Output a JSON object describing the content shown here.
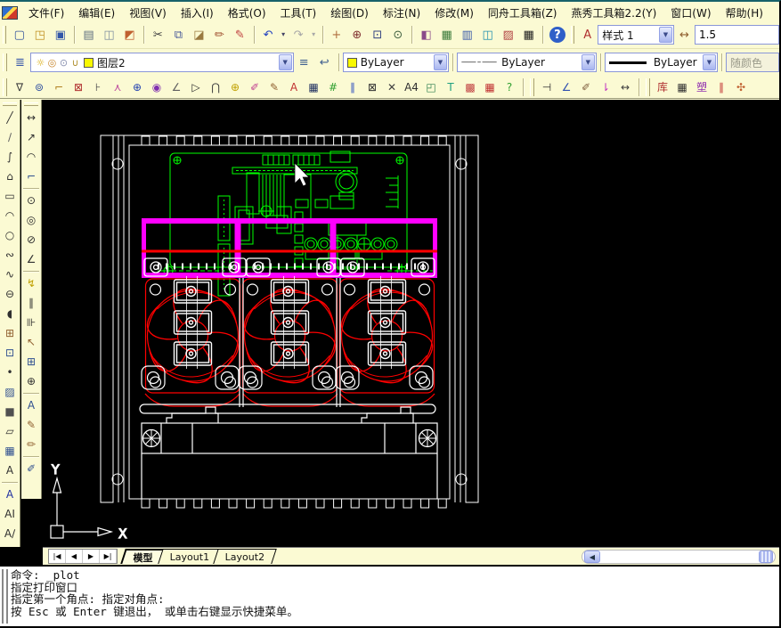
{
  "menu": {
    "items": [
      "文件(F)",
      "编辑(E)",
      "视图(V)",
      "插入(I)",
      "格式(O)",
      "工具(T)",
      "绘图(D)",
      "标注(N)",
      "修改(M)",
      "同舟工具箱(Z)",
      "燕秀工具箱2.2(Y)",
      "窗口(W)",
      "帮助(H)"
    ]
  },
  "ui": {
    "dropdown_arrow": "▼",
    "left_scroll_arrow": "◀"
  },
  "toolbar_standard": {
    "groups": [
      [
        {
          "n": "new-icon",
          "g": "▢",
          "c": "#33539c"
        },
        {
          "n": "open-icon",
          "g": "◳",
          "c": "#c09020"
        },
        {
          "n": "save-icon",
          "g": "▣",
          "c": "#3356a8"
        }
      ],
      [
        {
          "n": "plot-icon",
          "g": "▤",
          "c": "#607080"
        },
        {
          "n": "plot-preview-icon",
          "g": "◫",
          "c": "#8090a0"
        },
        {
          "n": "publish-icon",
          "g": "◩",
          "c": "#c06030"
        }
      ],
      [
        {
          "n": "cut-icon",
          "g": "✂",
          "c": "#404040"
        },
        {
          "n": "copy-icon",
          "g": "⧉",
          "c": "#4a5a9a"
        },
        {
          "n": "paste-icon",
          "g": "◪",
          "c": "#9a7a40"
        },
        {
          "n": "match-properties-icon",
          "g": "✏",
          "c": "#a05030"
        },
        {
          "n": "match-light-icon",
          "g": "✎",
          "c": "#c04040"
        }
      ],
      [
        {
          "n": "undo-icon",
          "g": "↶",
          "c": "#2040c0"
        },
        {
          "n": "undo-dropdown-icon",
          "g": "▾",
          "s": "caret"
        },
        {
          "n": "redo-icon",
          "g": "↷",
          "c": "#a8a8a8"
        },
        {
          "n": "redo-dropdown-icon",
          "g": "▾",
          "s": "caret",
          "c": "#a8a8a8"
        }
      ],
      [
        {
          "n": "pan-icon",
          "g": "+",
          "c": "#b07040"
        },
        {
          "n": "zoom-realtime-icon",
          "g": "⊕",
          "c": "#803030"
        },
        {
          "n": "zoom-window-icon",
          "g": "⊡",
          "c": "#304080"
        },
        {
          "n": "zoom-previous-icon",
          "g": "⊙",
          "c": "#406040"
        }
      ],
      [
        {
          "n": "properties-icon",
          "g": "◧",
          "c": "#8a4a8a"
        },
        {
          "n": "designcenter-icon",
          "g": "▦",
          "c": "#3a7a3a"
        },
        {
          "n": "tool-palettes-icon",
          "g": "▥",
          "c": "#3a5aaa"
        },
        {
          "n": "sheetset-icon",
          "g": "◫",
          "c": "#2090b0"
        },
        {
          "n": "markup-icon",
          "g": "▨",
          "c": "#b04040"
        },
        {
          "n": "quickcalc-icon",
          "g": "▦",
          "c": "#202020"
        }
      ],
      [
        {
          "n": "help-icon",
          "g": "?",
          "c": "#ffffff",
          "s": "help"
        }
      ]
    ],
    "text_style_icon": {
      "n": "text-style-icon",
      "g": "A",
      "c": "#b03030"
    },
    "style_value": "样式 1",
    "dim_style_icon": {
      "n": "dim-style-icon",
      "g": "↔",
      "c": "#906030"
    },
    "scale_value": "1.5"
  },
  "toolbar_layers": {
    "layers_icon": [
      {
        "n": "layers-icon",
        "g": "≣",
        "c": "#3a5aaa"
      }
    ],
    "layer_state_icons": [
      {
        "n": "bulb-on-icon",
        "g": "☼",
        "c": "#d8a800"
      },
      {
        "n": "freeze-sun-icon",
        "g": "◎",
        "c": "#c88830"
      },
      {
        "n": "viewport-freeze-icon",
        "g": "⊙",
        "c": "#8890b0"
      },
      {
        "n": "unlock-icon",
        "g": "∪",
        "c": "#b09030"
      }
    ],
    "layer_value": "图层2",
    "layer_swatch": "#f8f800",
    "buttons": [
      {
        "n": "make-object-layer-current-icon",
        "g": "≡",
        "c": "#406090"
      },
      {
        "n": "layer-previous-icon",
        "g": "↩",
        "c": "#406090"
      }
    ],
    "color_value": "ByLayer",
    "color_swatch": "#f8f800",
    "linetype_pattern": "—— – ——",
    "linetype_value": "ByLayer",
    "lineweight_value": "ByLayer",
    "plotstyle_value": "随颜色"
  },
  "toolbar_osnap": {
    "groups": [
      [
        {
          "n": "osnap-settings-icon",
          "g": "∇",
          "c": "#404040"
        },
        {
          "n": "snap-from-icon",
          "g": "⊚",
          "c": "#3050a0"
        },
        {
          "n": "snap-endpoint-icon",
          "g": "⌐",
          "c": "#b08020"
        },
        {
          "n": "snap-window-icon",
          "g": "⊠",
          "c": "#b03030"
        },
        {
          "n": "track-point-icon",
          "g": "⊦",
          "c": "#505050"
        },
        {
          "n": "snap-intersection-icon",
          "g": "⋏",
          "c": "#c050a0"
        },
        {
          "n": "snap-center-icon",
          "g": "⊕",
          "c": "#2040b0"
        },
        {
          "n": "snap-quadrant-icon",
          "g": "◉",
          "c": "#8030b0"
        },
        {
          "n": "snap-tangent-icon",
          "g": "∠",
          "c": "#606060"
        },
        {
          "n": "snap-perpendicular-icon",
          "g": "▷",
          "c": "#303030"
        },
        {
          "n": "snap-parallel-icon",
          "g": "⋂",
          "c": "#404040"
        },
        {
          "n": "snap-node-icon",
          "g": "⊕",
          "c": "#c0a000"
        },
        {
          "n": "colored-brush-icon",
          "g": "✐",
          "c": "#c04090"
        },
        {
          "n": "pencil-tool-icon",
          "g": "✎",
          "c": "#906030"
        },
        {
          "n": "text-tool-icon",
          "g": "A",
          "c": "#c03030"
        },
        {
          "n": "table-tool-icon",
          "g": "▦",
          "c": "#203060"
        },
        {
          "n": "grid-tool-icon",
          "g": "#",
          "c": "#30a030"
        },
        {
          "n": "column-tool-icon",
          "g": "∥",
          "c": "#3050c0"
        },
        {
          "n": "erase-tool-icon",
          "g": "⊠",
          "c": "#303030"
        },
        {
          "n": "break-tool-icon",
          "g": "✕",
          "c": "#404040"
        },
        {
          "n": "a4-paper-icon",
          "g": "A4",
          "c": "#303030"
        },
        {
          "n": "scale-tool-icon",
          "g": "◰",
          "c": "#308050"
        },
        {
          "n": "text-green-icon",
          "g": "T",
          "c": "#20a080"
        },
        {
          "n": "dim-table-icon",
          "g": "▩",
          "c": "#c04040"
        },
        {
          "n": "red-table-icon",
          "g": "▦",
          "c": "#c03030"
        },
        {
          "n": "yanxiu-help-icon",
          "g": "?",
          "c": "#30a030"
        }
      ],
      [
        {
          "n": "quick-linear-dim-icon",
          "g": "⊣",
          "c": "#303030"
        },
        {
          "n": "angle-dim-icon",
          "g": "∠",
          "c": "#3050b0"
        },
        {
          "n": "brush-dim-icon",
          "g": "✐",
          "c": "#806040"
        },
        {
          "n": "arrow-down-dim-icon",
          "g": "⇂",
          "c": "#c030c0"
        },
        {
          "n": "horizontal-dim-icon",
          "g": "↔",
          "c": "#404040"
        }
      ],
      [
        {
          "n": "library-icon",
          "g": "库",
          "c": "#b03030"
        },
        {
          "n": "moldbase-icon",
          "g": "▦",
          "c": "#303030"
        },
        {
          "n": "plastic-icon",
          "g": "塑",
          "c": "#9030b0"
        },
        {
          "n": "stripes-icon",
          "g": "∥",
          "c": "#c03030"
        },
        {
          "n": "flower-icon",
          "g": "✣",
          "c": "#c06030"
        }
      ]
    ]
  },
  "draw_toolbar": {
    "items": [
      {
        "n": "line-icon",
        "g": "╱",
        "c": "#303030"
      },
      {
        "n": "construction-line-icon",
        "g": "∕",
        "c": "#606060"
      },
      {
        "n": "polyline-icon",
        "g": "∫",
        "c": "#303030"
      },
      {
        "n": "polygon-icon",
        "g": "⌂",
        "c": "#303030"
      },
      {
        "n": "rectangle-icon",
        "g": "▭",
        "c": "#303030"
      },
      {
        "n": "arc-icon",
        "g": "◠",
        "c": "#303030"
      },
      {
        "n": "circle-icon",
        "g": "○",
        "c": "#303030"
      },
      {
        "n": "revcloud-icon",
        "g": "∾",
        "c": "#303030"
      },
      {
        "n": "spline-icon",
        "g": "∿",
        "c": "#303030"
      },
      {
        "n": "ellipse-icon",
        "g": "⊖",
        "c": "#303030"
      },
      {
        "n": "ellipse-arc-icon",
        "g": "◖",
        "c": "#303030"
      },
      {
        "n": "insert-block-icon",
        "g": "⊞",
        "c": "#906030"
      },
      {
        "n": "make-block-icon",
        "g": "⊡",
        "c": "#305090"
      },
      {
        "n": "point-icon",
        "g": "•",
        "c": "#303030"
      },
      {
        "n": "hatch-icon",
        "g": "▨",
        "c": "#305090"
      },
      {
        "n": "gradient-icon",
        "g": "■",
        "c": "#505050"
      },
      {
        "n": "region-icon",
        "g": "▱",
        "c": "#303030"
      },
      {
        "n": "table-icon",
        "g": "▦",
        "c": "#305090"
      },
      {
        "n": "mtext-icon",
        "g": "A",
        "c": "#303030"
      }
    ],
    "text_items": [
      {
        "n": "text-icon",
        "g": "A",
        "c": "#2030a0"
      },
      {
        "n": "single-line-text-icon",
        "g": "AI",
        "c": "#303030"
      },
      {
        "n": "edit-text-icon",
        "g": "A∕",
        "c": "#303030"
      }
    ]
  },
  "dim_toolbar": {
    "items1": [
      {
        "n": "linear-dimension-icon",
        "g": "↔",
        "c": "#303030"
      },
      {
        "n": "aligned-dimension-icon",
        "g": "↗",
        "c": "#303030"
      },
      {
        "n": "arc-length-dimension-icon",
        "g": "◠",
        "c": "#303030"
      },
      {
        "n": "ordinate-dimension-icon",
        "g": "⌐",
        "c": "#305090"
      }
    ],
    "items2": [
      {
        "n": "radius-dimension-icon",
        "g": "⊙",
        "c": "#303030"
      },
      {
        "n": "jogged-dimension-icon",
        "g": "◎",
        "c": "#303030"
      },
      {
        "n": "diameter-dimension-icon",
        "g": "⊘",
        "c": "#303030"
      },
      {
        "n": "angular-dimension-icon",
        "g": "∠",
        "c": "#303030"
      }
    ],
    "items3": [
      {
        "n": "quick-dimension-icon",
        "g": "↯",
        "c": "#c0a000"
      },
      {
        "n": "baseline-dimension-icon",
        "g": "∥",
        "c": "#303030"
      },
      {
        "n": "continue-dimension-icon",
        "g": "⊪",
        "c": "#303030"
      },
      {
        "n": "quick-leader-icon",
        "g": "↖",
        "c": "#906030"
      },
      {
        "n": "tolerance-icon",
        "g": "⊞",
        "c": "#305090"
      },
      {
        "n": "center-mark-icon",
        "g": "⊕",
        "c": "#303030"
      }
    ],
    "items4": [
      {
        "n": "dimension-text-icon",
        "g": "A",
        "c": "#305090"
      },
      {
        "n": "dimension-edit-icon",
        "g": "✎",
        "c": "#906030"
      },
      {
        "n": "dimension-text-edit-icon",
        "g": "✏",
        "c": "#906030"
      }
    ],
    "items5": [
      {
        "n": "dimension-update-icon",
        "g": "✐",
        "c": "#305090"
      }
    ]
  },
  "canvas": {
    "ucs": {
      "x_label": "X",
      "y_label": "Y"
    },
    "colors": {
      "background": "#000000",
      "outline": "#ffffff",
      "pcb": "#00ff00",
      "fans": "#ff0000",
      "busbar": "#ff00ff"
    }
  },
  "layout_tabs": {
    "nav": [
      {
        "n": "tab-first-icon",
        "g": "|◀"
      },
      {
        "n": "tab-prev-icon",
        "g": "◀"
      },
      {
        "n": "tab-next-icon",
        "g": "▶"
      },
      {
        "n": "tab-last-icon",
        "g": "▶|"
      }
    ],
    "tabs": [
      {
        "label": "模型",
        "active": true
      },
      {
        "label": "Layout1",
        "active": false
      },
      {
        "label": "Layout2",
        "active": false
      }
    ]
  },
  "command": {
    "lines": [
      "命令: _plot",
      "指定打印窗口",
      "指定第一个角点: 指定对角点:",
      "按 Esc 或 Enter 键退出， 或单击右键显示快捷菜单。"
    ]
  }
}
